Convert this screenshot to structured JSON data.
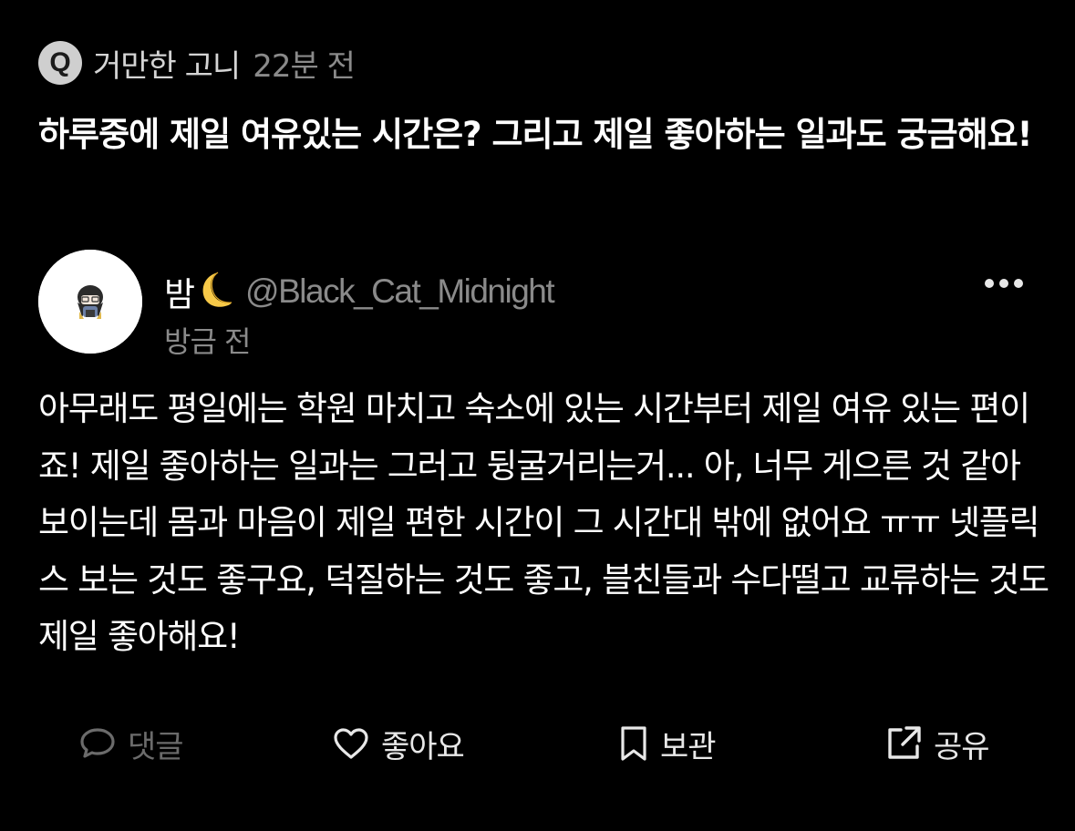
{
  "question": {
    "badge_letter": "Q",
    "asker_name": "거만한 고니",
    "time": "22분 전",
    "text": "하루중에 제일 여유있는 시간은? 그리고 제일 좋아하는 일과도 궁금해요!"
  },
  "answer": {
    "display_name": "밤",
    "name_emoji_icon": "crescent-moon-icon",
    "handle": "@Black_Cat_Midnight",
    "time": "방금 전",
    "text": "아무래도 평일에는 학원 마치고 숙소에 있는 시간부터 제일 여유 있는 편이죠! 제일 좋아하는 일과는 그러고 뒹굴거리는거... 아, 너무 게으른 것 같아 보이는데 몸과 마음이 제일 편한 시간이 그 시간대 밖에 없어요 ㅠㅠ 넷플릭스 보는 것도 좋구요, 덕질하는 것도 좋고, 블친들과 수다떨고 교류하는 것도 제일 좋아해요!"
  },
  "actions": {
    "comment_label": "댓글",
    "like_label": "좋아요",
    "bookmark_label": "보관",
    "share_label": "공유"
  },
  "colors": {
    "background": "#000000",
    "muted_text": "#8a8a8a",
    "disabled_action": "#6b6b6b",
    "moon": "#f7c948"
  }
}
